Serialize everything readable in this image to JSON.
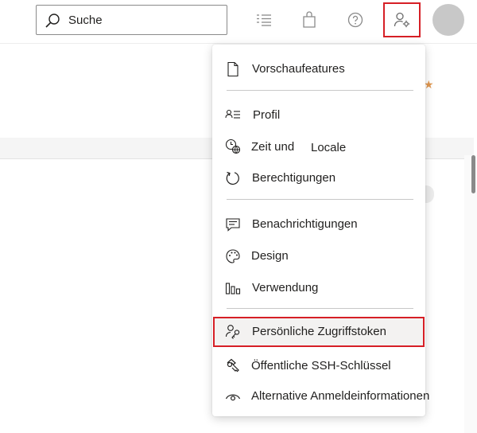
{
  "search": {
    "placeholder": "Suche"
  },
  "menu": {
    "group1": {
      "preview": "Vorschaufeatures"
    },
    "group2": {
      "profile": "Profil",
      "time_a": "Zeit und",
      "time_b": "Locale",
      "permissions": "Berechtigungen"
    },
    "group3": {
      "notifications": "Benachrichtigungen",
      "design": "Design",
      "usage": "Verwendung"
    },
    "group4": {
      "pat": "Persönliche Zugriffstoken",
      "ssh": "Öffentliche SSH-Schlüssel",
      "alt_creds": "Alternative Anmeldeinformationen"
    }
  },
  "icons": {
    "topbar": [
      "search-icon",
      "task-list-icon",
      "shopping-bag-icon",
      "help-icon",
      "user-settings-icon"
    ],
    "menu": [
      "page-icon",
      "contact-card-icon",
      "time-globe-icon",
      "refresh-icon",
      "comment-icon",
      "palette-icon",
      "bar-chart-icon",
      "person-key-icon",
      "ssh-key-icon",
      "eye-icon"
    ]
  },
  "colors": {
    "highlight_border": "#d61f26",
    "hover_bg": "#f3f2f1",
    "accent_star": "#e0974f"
  }
}
